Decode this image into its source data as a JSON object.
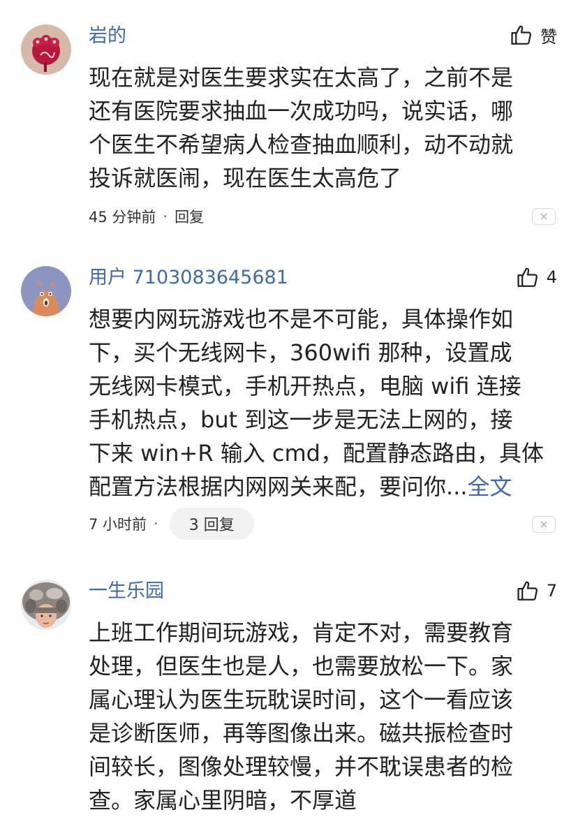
{
  "comments": [
    {
      "username": "岩的",
      "like_label": "赞",
      "body": [
        "现在就是对医生要求实在太高了，之前不是",
        "还有医院要求抽血一次成功吗，说实话，哪",
        "个医生不希望病人检查抽血顺利，动不动就",
        "投诉就医闹，现在医生太高危了"
      ],
      "time": "45 分钟前",
      "reply_label": "回复"
    },
    {
      "username": "用户 7103083645681",
      "like_count": "4",
      "body": [
        "想要内网玩游戏也不是不可能，具体操作如",
        "下，买个无线网卡，360wifi 那种，设置成",
        "无线网卡模式，手机开热点，电脑 wifi 连接",
        "手机热点，but 到这一步是无法上网的，接",
        "下来 win+R 输入 cmd，配置静态路由，具体"
      ],
      "body_last": "配置方法根据内网网关来配，要问你...",
      "more_label": "全文",
      "time": "7 小时前",
      "reply_label": "3 回复"
    },
    {
      "username": "一生乐园",
      "like_count": "7",
      "body": [
        "上班工作期间玩游戏，肯定不对，需要教育",
        "处理，但医生也是人，也需要放松一下。家",
        "属心理认为医生玩耽误时间，这个一看应该",
        "是诊断医师，再等图像出来。磁共振检查时",
        "间较长，图像处理较慢，并不耽误患者的检",
        "查。家属心里阴暗，不厚道"
      ]
    }
  ],
  "separator_dot": "·"
}
